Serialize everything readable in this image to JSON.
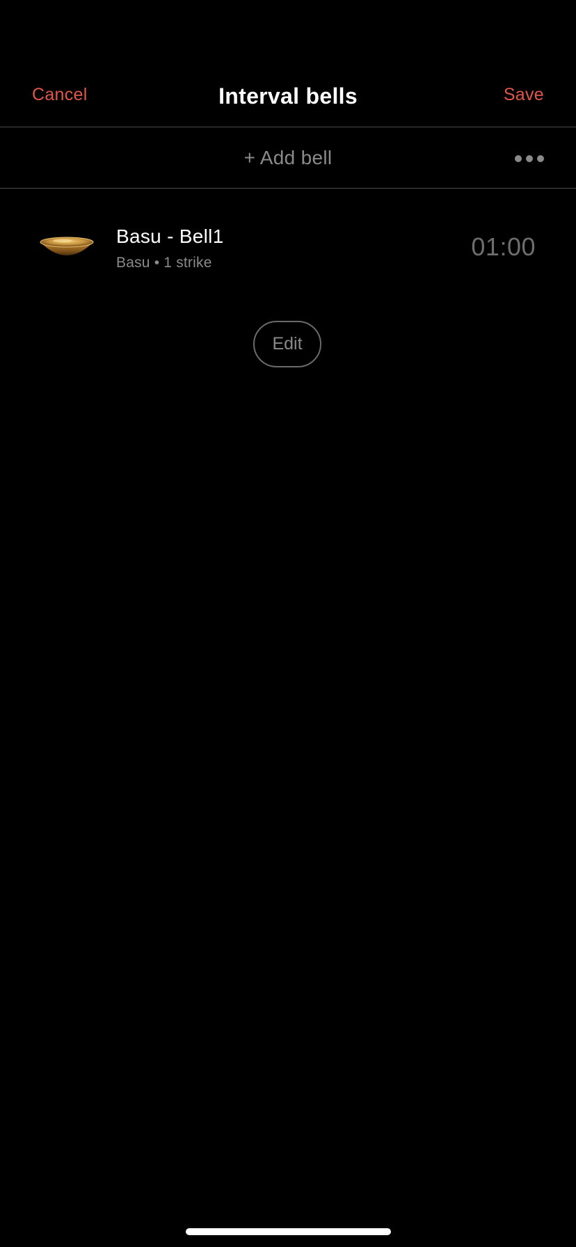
{
  "header": {
    "cancel_label": "Cancel",
    "title": "Interval bells",
    "save_label": "Save"
  },
  "toolbar": {
    "add_bell_label": "+ Add bell",
    "more_icon": "more-horizontal-icon"
  },
  "bells": [
    {
      "name": "Basu - Bell1",
      "meta": "Basu • 1 strike",
      "time": "01:00",
      "icon": "singing-bowl-icon"
    }
  ],
  "edit_label": "Edit",
  "colors": {
    "accent": "#e0574a",
    "background": "#000000",
    "muted_text": "#8a8a8a",
    "divider": "#4a4a4a"
  }
}
